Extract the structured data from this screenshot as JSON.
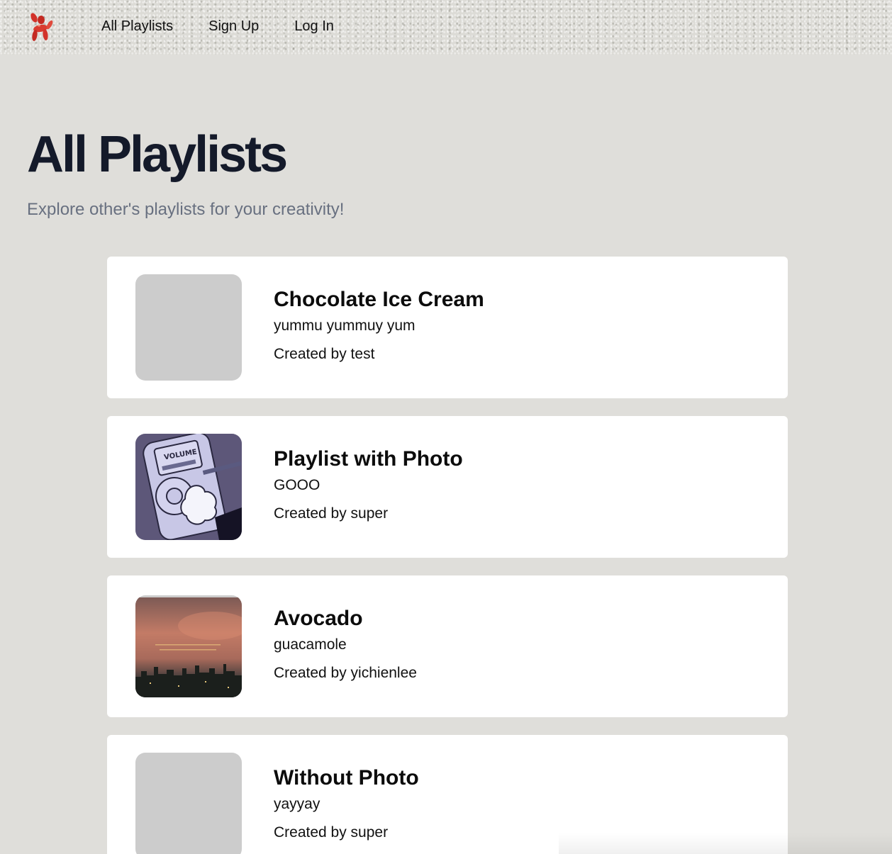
{
  "nav": {
    "logo_icon": "balloon-dog-icon",
    "links": [
      {
        "label": "All Playlists"
      },
      {
        "label": "Sign Up"
      },
      {
        "label": "Log In"
      }
    ]
  },
  "header": {
    "title": "All Playlists",
    "subtitle": "Explore other's playlists for your creativity!"
  },
  "playlists": [
    {
      "title": "Chocolate Ice Cream",
      "description": "yummu yummuy yum",
      "author": "Created by test",
      "has_photo": false
    },
    {
      "title": "Playlist with Photo",
      "description": "GOOO",
      "author": "Created by super",
      "has_photo": true,
      "photo_caption": "VOLUME"
    },
    {
      "title": "Avocado",
      "description": "guacamole",
      "author": "Created by yichienlee",
      "has_photo": true
    },
    {
      "title": "Without Photo",
      "description": "yayyay",
      "author": "Created by super",
      "has_photo": false
    }
  ],
  "colors": {
    "page_bg": "#dfdeda",
    "card_bg": "#ffffff",
    "placeholder": "#cccccc",
    "title": "#141a2a",
    "subtitle": "#687080",
    "logo_red": "#d2322a"
  }
}
